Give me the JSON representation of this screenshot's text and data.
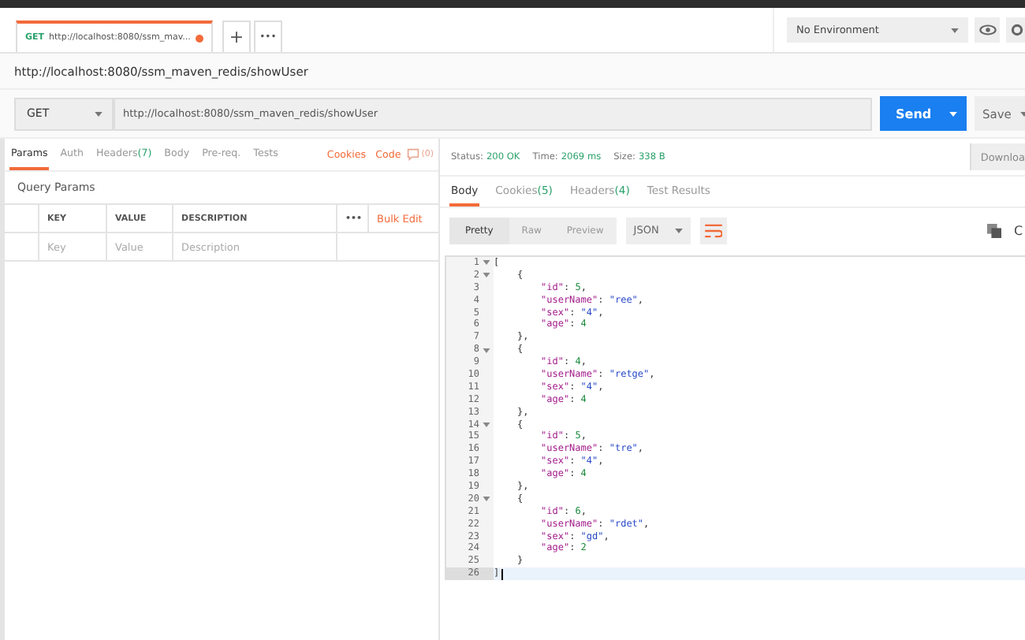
{
  "tabs": [
    {
      "method": "GET",
      "title": "http://localhost:8080/ssm_mav...",
      "unsaved": true,
      "selected": true
    }
  ],
  "tab_actions": {
    "add": "+",
    "more": "•••"
  },
  "environment": {
    "value": "No Environment"
  },
  "request_title": "http://localhost:8080/ssm_maven_redis/showUser",
  "request": {
    "method": "GET",
    "url": "http://localhost:8080/ssm_maven_redis/showUser",
    "send": "Send",
    "save": "Save"
  },
  "request_tabs": [
    {
      "label": "Params",
      "selected": true
    },
    {
      "label": "Auth",
      "selected": false
    },
    {
      "label": "Headers",
      "count": "(7)",
      "selected": false
    },
    {
      "label": "Body",
      "selected": false
    },
    {
      "label": "Pre-req.",
      "selected": false
    },
    {
      "label": "Tests",
      "selected": false
    }
  ],
  "request_links": [
    "Cookies",
    "Code"
  ],
  "comments": "(0)",
  "query_params": {
    "title": "Query Params",
    "columns": [
      "KEY",
      "VALUE",
      "DESCRIPTION"
    ],
    "more": "•••",
    "bulk_edit": "Bulk Edit",
    "placeholders": [
      "Key",
      "Value",
      "Description"
    ]
  },
  "status": [
    {
      "label": "Status:",
      "value": "200 OK"
    },
    {
      "label": "Time:",
      "value": "2069 ms"
    },
    {
      "label": "Size:",
      "value": "338 B"
    }
  ],
  "download": "Downloa",
  "response_tabs": [
    {
      "label": "Body",
      "selected": true
    },
    {
      "label": "Cookies",
      "count": "(5)",
      "selected": false
    },
    {
      "label": "Headers",
      "count": "(4)",
      "selected": false
    },
    {
      "label": "Test Results",
      "selected": false
    }
  ],
  "view_modes": [
    {
      "label": "Pretty",
      "selected": true
    },
    {
      "label": "Raw",
      "selected": false
    },
    {
      "label": "Preview",
      "selected": false
    }
  ],
  "format": "JSON",
  "copy_cut": "C",
  "code_lines": [
    {
      "number": "1",
      "kind": "outer",
      "foldable": true,
      "current": false,
      "tokens": [
        {
          "kind": "punct",
          "text": "["
        }
      ]
    },
    {
      "number": "2",
      "kind": "brace",
      "foldable": true,
      "current": false,
      "tokens": [
        {
          "kind": "punct",
          "text": "{"
        }
      ]
    },
    {
      "number": "3",
      "kind": "prop",
      "foldable": false,
      "current": false,
      "tokens": [
        {
          "kind": "key",
          "text": "\"id\""
        },
        {
          "kind": "punct",
          "text": ": "
        },
        {
          "kind": "number",
          "text": "5"
        },
        {
          "kind": "punct",
          "text": ","
        }
      ]
    },
    {
      "number": "4",
      "kind": "prop",
      "foldable": false,
      "current": false,
      "tokens": [
        {
          "kind": "key",
          "text": "\"userName\""
        },
        {
          "kind": "punct",
          "text": ": "
        },
        {
          "kind": "string",
          "text": "\"ree\""
        },
        {
          "kind": "punct",
          "text": ","
        }
      ]
    },
    {
      "number": "5",
      "kind": "prop",
      "foldable": false,
      "current": false,
      "tokens": [
        {
          "kind": "key",
          "text": "\"sex\""
        },
        {
          "kind": "punct",
          "text": ": "
        },
        {
          "kind": "string",
          "text": "\"4\""
        },
        {
          "kind": "punct",
          "text": ","
        }
      ]
    },
    {
      "number": "6",
      "kind": "prop",
      "foldable": false,
      "current": false,
      "tokens": [
        {
          "kind": "key",
          "text": "\"age\""
        },
        {
          "kind": "punct",
          "text": ": "
        },
        {
          "kind": "number",
          "text": "4"
        }
      ]
    },
    {
      "number": "7",
      "kind": "brace",
      "foldable": false,
      "current": false,
      "tokens": [
        {
          "kind": "punct",
          "text": "},"
        }
      ]
    },
    {
      "number": "8",
      "kind": "brace",
      "foldable": true,
      "current": false,
      "tokens": [
        {
          "kind": "punct",
          "text": "{"
        }
      ]
    },
    {
      "number": "9",
      "kind": "prop",
      "foldable": false,
      "current": false,
      "tokens": [
        {
          "kind": "key",
          "text": "\"id\""
        },
        {
          "kind": "punct",
          "text": ": "
        },
        {
          "kind": "number",
          "text": "4"
        },
        {
          "kind": "punct",
          "text": ","
        }
      ]
    },
    {
      "number": "10",
      "kind": "prop",
      "foldable": false,
      "current": false,
      "tokens": [
        {
          "kind": "key",
          "text": "\"userName\""
        },
        {
          "kind": "punct",
          "text": ": "
        },
        {
          "kind": "string",
          "text": "\"retge\""
        },
        {
          "kind": "punct",
          "text": ","
        }
      ]
    },
    {
      "number": "11",
      "kind": "prop",
      "foldable": false,
      "current": false,
      "tokens": [
        {
          "kind": "key",
          "text": "\"sex\""
        },
        {
          "kind": "punct",
          "text": ": "
        },
        {
          "kind": "string",
          "text": "\"4\""
        },
        {
          "kind": "punct",
          "text": ","
        }
      ]
    },
    {
      "number": "12",
      "kind": "prop",
      "foldable": false,
      "current": false,
      "tokens": [
        {
          "kind": "key",
          "text": "\"age\""
        },
        {
          "kind": "punct",
          "text": ": "
        },
        {
          "kind": "number",
          "text": "4"
        }
      ]
    },
    {
      "number": "13",
      "kind": "brace",
      "foldable": false,
      "current": false,
      "tokens": [
        {
          "kind": "punct",
          "text": "},"
        }
      ]
    },
    {
      "number": "14",
      "kind": "brace",
      "foldable": true,
      "current": false,
      "tokens": [
        {
          "kind": "punct",
          "text": "{"
        }
      ]
    },
    {
      "number": "15",
      "kind": "prop",
      "foldable": false,
      "current": false,
      "tokens": [
        {
          "kind": "key",
          "text": "\"id\""
        },
        {
          "kind": "punct",
          "text": ": "
        },
        {
          "kind": "number",
          "text": "5"
        },
        {
          "kind": "punct",
          "text": ","
        }
      ]
    },
    {
      "number": "16",
      "kind": "prop",
      "foldable": false,
      "current": false,
      "tokens": [
        {
          "kind": "key",
          "text": "\"userName\""
        },
        {
          "kind": "punct",
          "text": ": "
        },
        {
          "kind": "string",
          "text": "\"tre\""
        },
        {
          "kind": "punct",
          "text": ","
        }
      ]
    },
    {
      "number": "17",
      "kind": "prop",
      "foldable": false,
      "current": false,
      "tokens": [
        {
          "kind": "key",
          "text": "\"sex\""
        },
        {
          "kind": "punct",
          "text": ": "
        },
        {
          "kind": "string",
          "text": "\"4\""
        },
        {
          "kind": "punct",
          "text": ","
        }
      ]
    },
    {
      "number": "18",
      "kind": "prop",
      "foldable": false,
      "current": false,
      "tokens": [
        {
          "kind": "key",
          "text": "\"age\""
        },
        {
          "kind": "punct",
          "text": ": "
        },
        {
          "kind": "number",
          "text": "4"
        }
      ]
    },
    {
      "number": "19",
      "kind": "brace",
      "foldable": false,
      "current": false,
      "tokens": [
        {
          "kind": "punct",
          "text": "},"
        }
      ]
    },
    {
      "number": "20",
      "kind": "brace",
      "foldable": true,
      "current": false,
      "tokens": [
        {
          "kind": "punct",
          "text": "{"
        }
      ]
    },
    {
      "number": "21",
      "kind": "prop",
      "foldable": false,
      "current": false,
      "tokens": [
        {
          "kind": "key",
          "text": "\"id\""
        },
        {
          "kind": "punct",
          "text": ": "
        },
        {
          "kind": "number",
          "text": "6"
        },
        {
          "kind": "punct",
          "text": ","
        }
      ]
    },
    {
      "number": "22",
      "kind": "prop",
      "foldable": false,
      "current": false,
      "tokens": [
        {
          "kind": "key",
          "text": "\"userName\""
        },
        {
          "kind": "punct",
          "text": ": "
        },
        {
          "kind": "string",
          "text": "\"rdet\""
        },
        {
          "kind": "punct",
          "text": ","
        }
      ]
    },
    {
      "number": "23",
      "kind": "prop",
      "foldable": false,
      "current": false,
      "tokens": [
        {
          "kind": "key",
          "text": "\"sex\""
        },
        {
          "kind": "punct",
          "text": ": "
        },
        {
          "kind": "string",
          "text": "\"gd\""
        },
        {
          "kind": "punct",
          "text": ","
        }
      ]
    },
    {
      "number": "24",
      "kind": "prop",
      "foldable": false,
      "current": false,
      "tokens": [
        {
          "kind": "key",
          "text": "\"age\""
        },
        {
          "kind": "punct",
          "text": ": "
        },
        {
          "kind": "number",
          "text": "2"
        }
      ]
    },
    {
      "number": "25",
      "kind": "brace",
      "foldable": false,
      "current": false,
      "tokens": [
        {
          "kind": "punct",
          "text": "}"
        }
      ]
    },
    {
      "number": "26",
      "kind": "outer",
      "foldable": false,
      "current": true,
      "tokens": [
        {
          "kind": "punct",
          "text": "]"
        }
      ]
    }
  ]
}
